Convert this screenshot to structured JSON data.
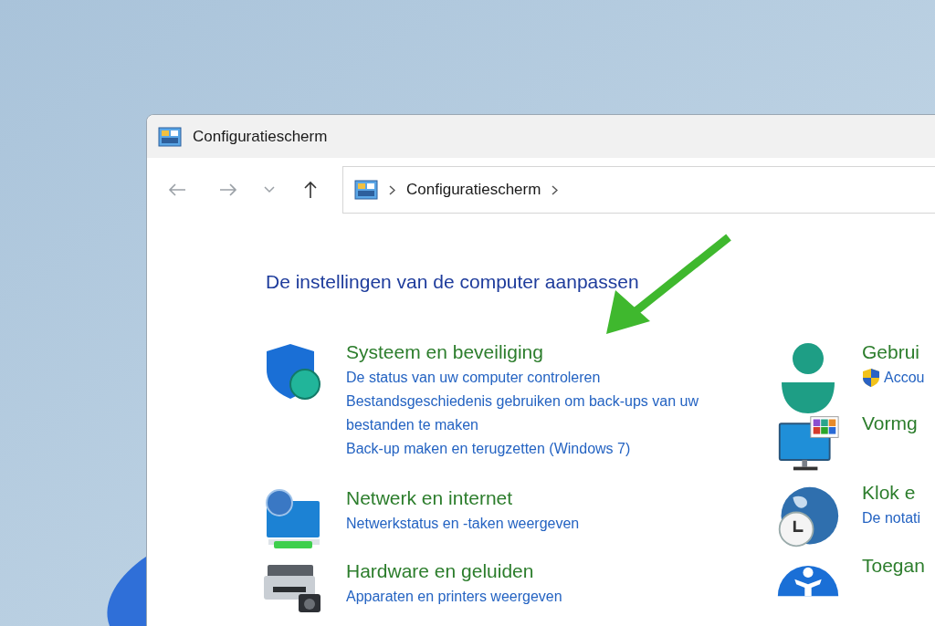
{
  "window": {
    "title": "Configuratiescherm"
  },
  "address_bar": {
    "path": [
      "Configuratiescherm"
    ]
  },
  "heading": "De instellingen van de computer aanpassen",
  "left_column": [
    {
      "title": "Systeem en beveiliging",
      "links": [
        {
          "kind": "plain",
          "text": "De status van uw computer controleren"
        },
        {
          "kind": "plain",
          "text": "Bestandsgeschiedenis gebruiken om back-ups van uw bestanden te maken"
        },
        {
          "kind": "plain",
          "text": "Back-up maken en terugzetten (Windows 7)"
        }
      ]
    },
    {
      "title": "Netwerk en internet",
      "links": [
        {
          "kind": "plain",
          "text": "Netwerkstatus en -taken weergeven"
        }
      ]
    },
    {
      "title": "Hardware en geluiden",
      "links": [
        {
          "kind": "plain",
          "text": "Apparaten en printers weergeven"
        }
      ]
    }
  ],
  "right_column": [
    {
      "title": "Gebrui",
      "links": [
        {
          "kind": "shield",
          "text": "Accou"
        }
      ]
    },
    {
      "title": "Vormg"
    },
    {
      "title": "Klok e",
      "links": [
        {
          "kind": "plain",
          "text": "De notati"
        }
      ]
    },
    {
      "title": "Toegan"
    }
  ]
}
